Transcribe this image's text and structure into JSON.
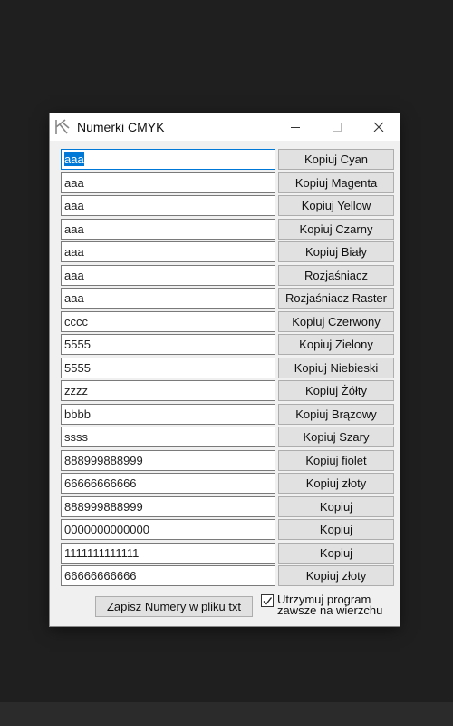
{
  "window": {
    "title": "Numerki CMYK"
  },
  "rows": [
    {
      "value": "aaa",
      "button": "Kopiuj Cyan"
    },
    {
      "value": "aaa",
      "button": "Kopiuj Magenta"
    },
    {
      "value": "aaa",
      "button": "Kopiuj Yellow"
    },
    {
      "value": "aaa",
      "button": "Kopiuj Czarny"
    },
    {
      "value": "aaa",
      "button": "Kopiuj Biały"
    },
    {
      "value": "aaa",
      "button": "Rozjaśniacz"
    },
    {
      "value": "aaa",
      "button": "Rozjaśniacz Raster"
    },
    {
      "value": "cccc",
      "button": "Kopiuj Czerwony"
    },
    {
      "value": "5555",
      "button": "Kopiuj Zielony"
    },
    {
      "value": "5555",
      "button": "Kopiuj Niebieski"
    },
    {
      "value": "zzzz",
      "button": "Kopiuj Żółty"
    },
    {
      "value": "bbbb",
      "button": "Kopiuj Brązowy"
    },
    {
      "value": "ssss",
      "button": "Kopiuj Szary"
    },
    {
      "value": "888999888999",
      "button": "Kopiuj fiolet"
    },
    {
      "value": "66666666666",
      "button": "Kopiuj złoty"
    },
    {
      "value": "888999888999",
      "button": "Kopiuj"
    },
    {
      "value": "0000000000000",
      "button": "Kopiuj"
    },
    {
      "value": "1111111111111",
      "button": "Kopiuj"
    },
    {
      "value": "66666666666",
      "button": "Kopiuj złoty"
    }
  ],
  "footer": {
    "save_label": "Zapisz Numery w pliku txt",
    "keep_on_top_line1": "Utrzymuj program",
    "keep_on_top_line2": "zawsze na wierzchu",
    "keep_on_top_checked": true
  }
}
